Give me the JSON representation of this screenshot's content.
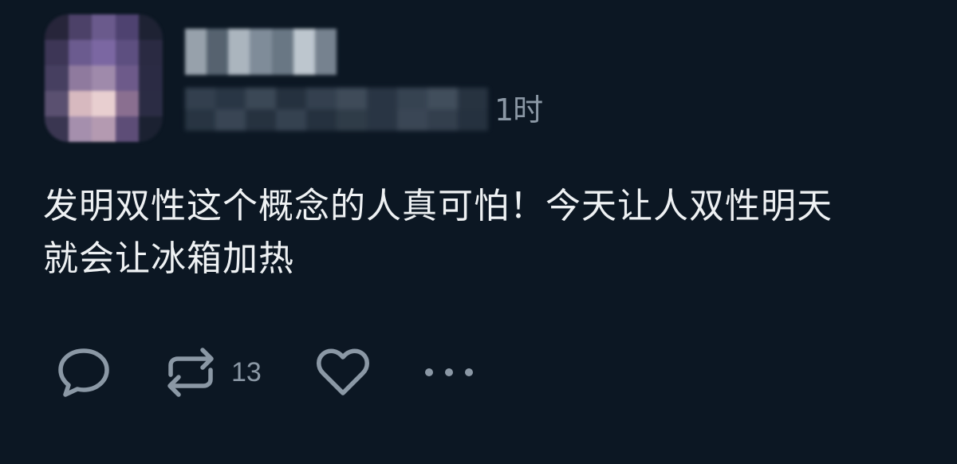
{
  "post": {
    "timestamp": "1时",
    "text": "发明双性这个概念的人真可怕！今天让人双性明天\n就会让冰箱加热"
  },
  "actions": {
    "reply_icon": "speech-bubble-icon",
    "repost_icon": "repost-arrows-icon",
    "repost_count": "13",
    "like_icon": "heart-icon",
    "more_icon": "ellipsis-icon"
  },
  "colors": {
    "background": "#0c1723",
    "text": "#eef1f3",
    "muted": "#8b98a5"
  }
}
